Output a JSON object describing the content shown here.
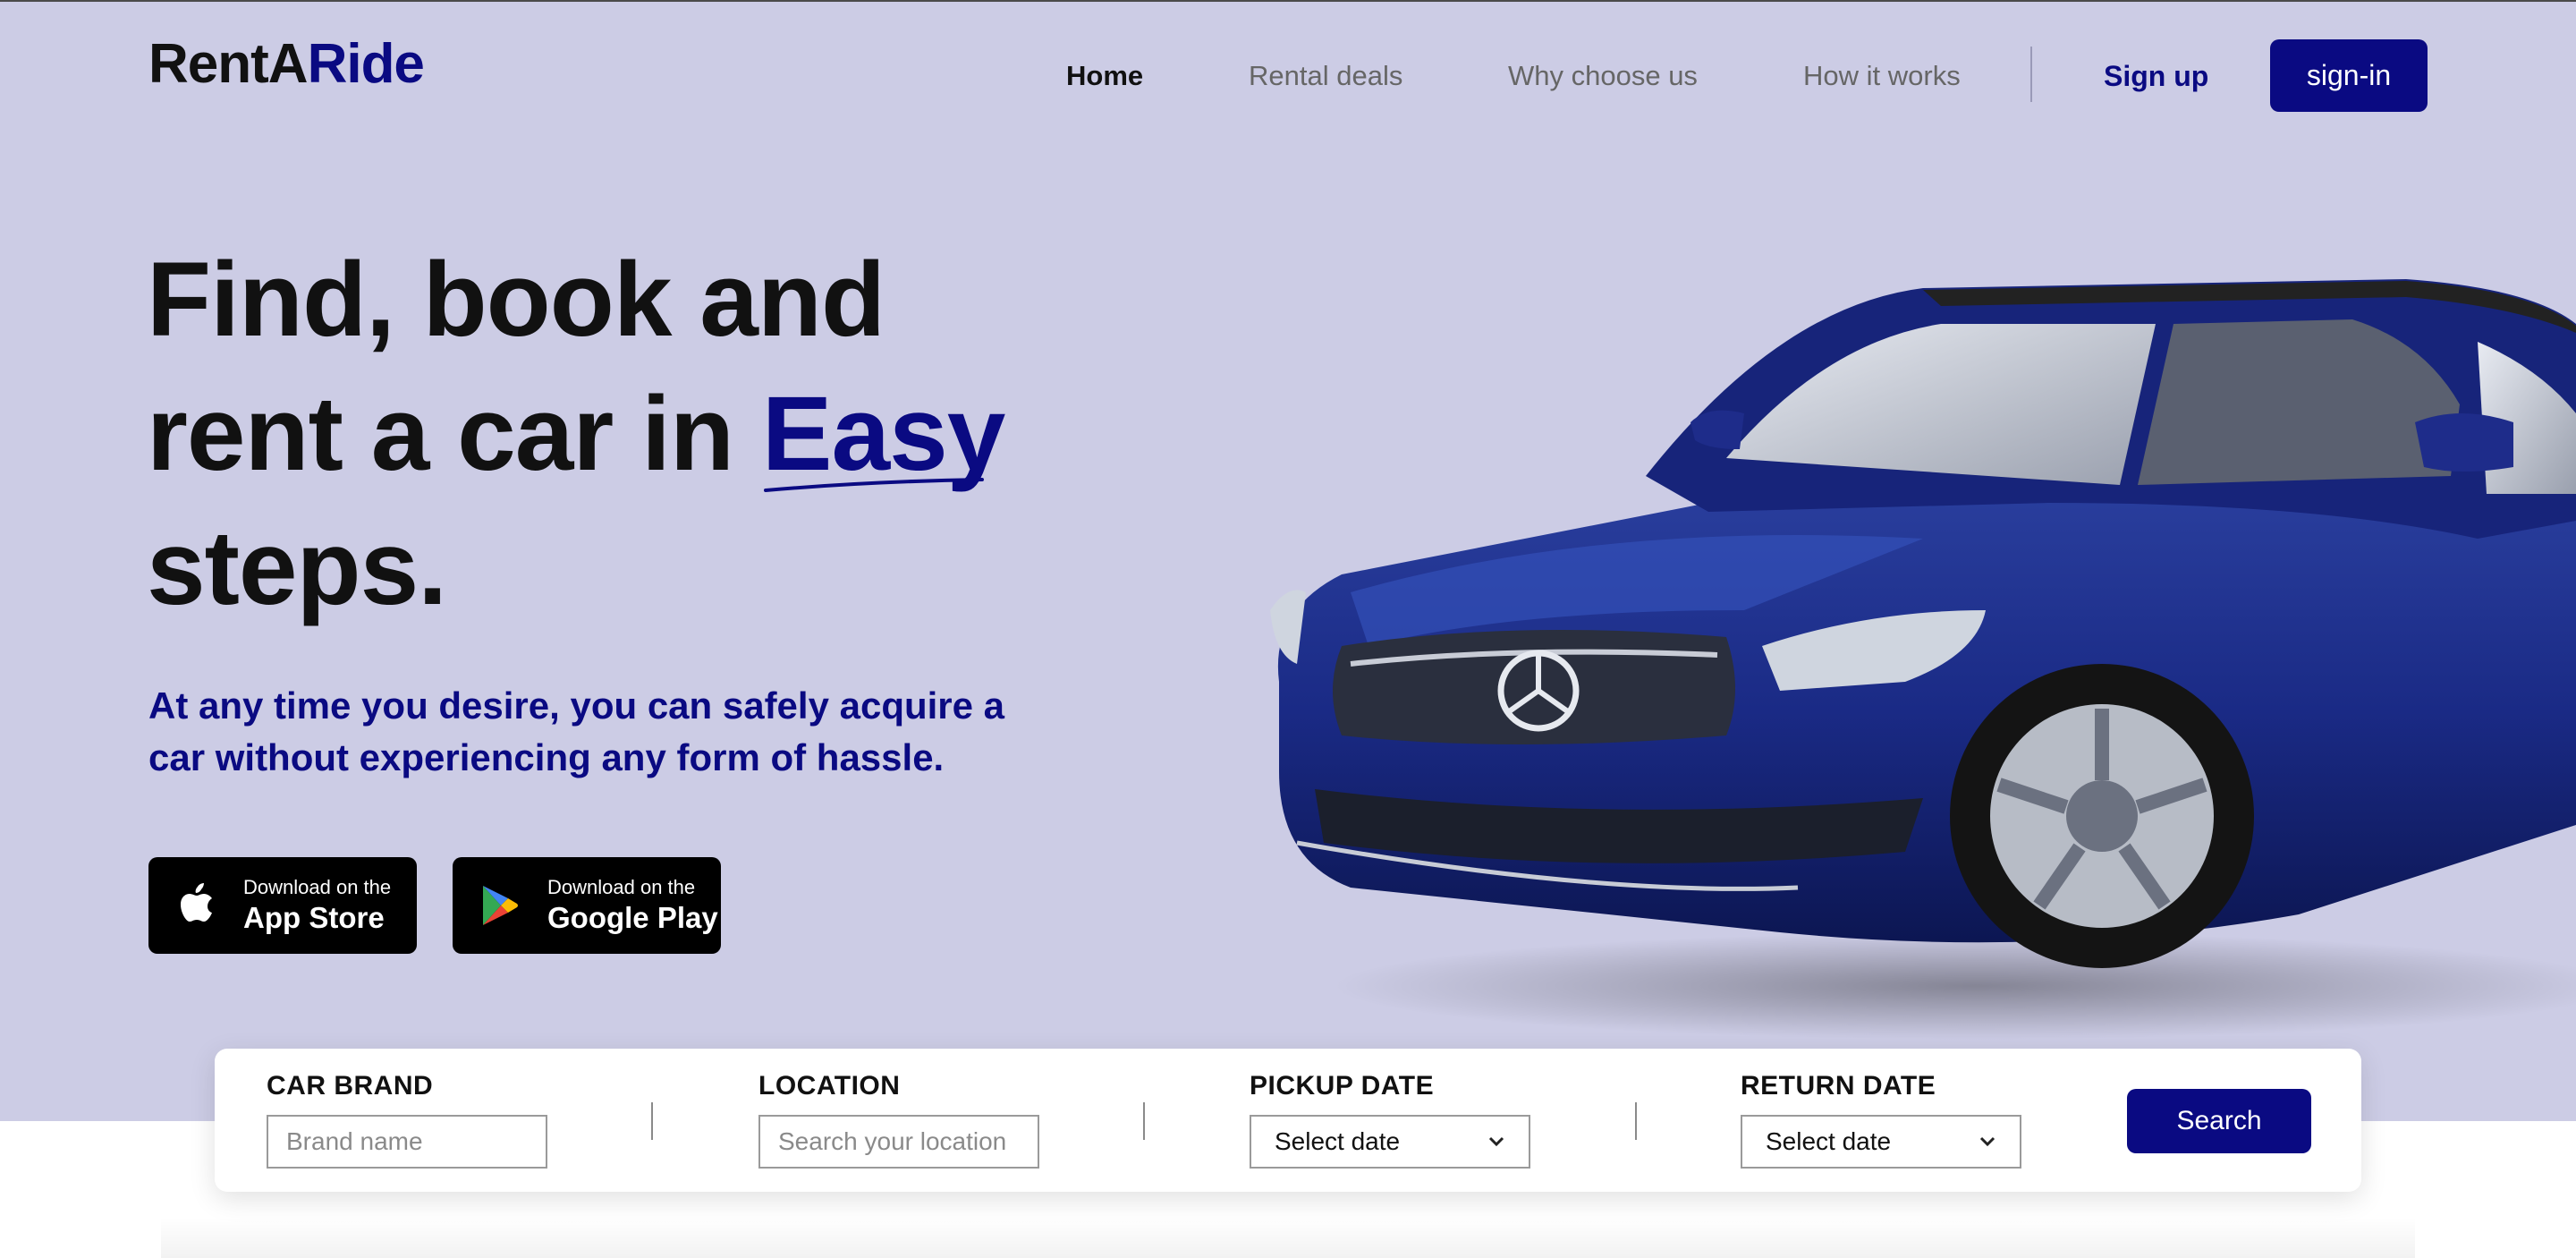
{
  "brand": {
    "logo_part1": "RentA",
    "logo_part2": "Ride"
  },
  "nav": {
    "links": [
      "Home",
      "Rental deals",
      "Why choose us",
      "How it works"
    ],
    "signup": "Sign up",
    "signin": "sign-in"
  },
  "hero": {
    "headline_line1": "Find, book and",
    "headline_line2_prefix": "rent a car in ",
    "headline_highlight": "Easy",
    "headline_line3": "steps.",
    "subtitle": "At any time you desire, you can safely acquire a car without experiencing any form of hassle."
  },
  "stores": {
    "app_store": {
      "small": "Download on the",
      "big": "App Store",
      "icon": "apple-icon"
    },
    "google_play": {
      "small": "Download on the",
      "big": "Google Play",
      "icon": "google-play-icon"
    }
  },
  "search": {
    "car_brand_label": "CAR BRAND",
    "car_brand_placeholder": "Brand name",
    "location_label": "LOCATION",
    "location_placeholder": "Search your location",
    "pickup_label": "PICKUP DATE",
    "pickup_value": "Select date",
    "return_label": "RETURN DATE",
    "return_value": "Select date",
    "button": "Search"
  },
  "colors": {
    "primary": "#0a0a82",
    "hero_bg": "#cccce5",
    "text": "#111111",
    "nav_muted": "#666666"
  }
}
